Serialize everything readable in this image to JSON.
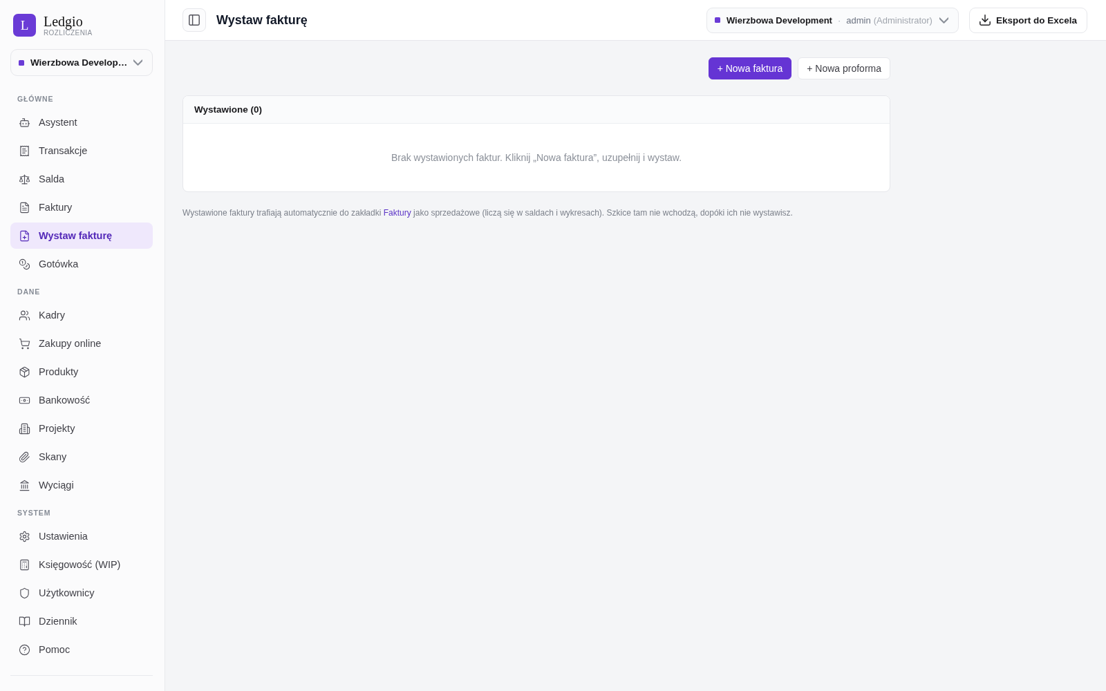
{
  "sidebar": {
    "logo": {
      "letter": "L",
      "name": "Ledgio",
      "subtitle": "ROZLICZENIA"
    },
    "company_selector": {
      "label": "Wierzbowa Develop…"
    },
    "sections": [
      {
        "title": "GŁÓWNE",
        "items": [
          {
            "label": "Asystent",
            "selected": false
          },
          {
            "label": "Transakcje",
            "selected": false
          },
          {
            "label": "Salda",
            "selected": false
          },
          {
            "label": "Faktury",
            "selected": false
          },
          {
            "label": "Wystaw fakturę",
            "selected": true
          },
          {
            "label": "Gotówka",
            "selected": false
          }
        ]
      },
      {
        "title": "DANE",
        "items": [
          {
            "label": "Kadry",
            "selected": false
          },
          {
            "label": "Zakupy online",
            "selected": false
          },
          {
            "label": "Produkty",
            "selected": false
          },
          {
            "label": "Bankowość",
            "selected": false
          },
          {
            "label": "Projekty",
            "selected": false
          },
          {
            "label": "Skany",
            "selected": false
          },
          {
            "label": "Wyciągi",
            "selected": false
          }
        ]
      },
      {
        "title": "SYSTEM",
        "items": [
          {
            "label": "Ustawienia",
            "selected": false
          },
          {
            "label": "Księgowość (WIP)",
            "selected": false
          },
          {
            "label": "Użytkownicy",
            "selected": false
          },
          {
            "label": "Dziennik",
            "selected": false
          },
          {
            "label": "Pomoc",
            "selected": false
          }
        ]
      }
    ]
  },
  "header": {
    "title": "Wystaw fakturę",
    "account": {
      "company": "Wierzbowa Development",
      "separator": "·",
      "user": "admin",
      "role": "(Administrator)"
    },
    "export_button": "Eksport do Excela"
  },
  "actions": [
    {
      "label": "+ Nowa faktura",
      "kind": "primary"
    },
    {
      "label": "+ Nowa proforma",
      "kind": "secondary"
    }
  ],
  "issued_panel": {
    "title": "Wystawione (0)",
    "empty_message": "Brak wystawionych faktur. Kliknij „Nowa faktura”, uzupełnij i wystaw."
  },
  "footnote": {
    "text_before": "Wystawione faktury trafiają automatycznie do zakładki",
    "link": "Faktury",
    "text_after": "jako sprzedażowe (liczą się w saldach i wykresach). Szkice tam nie wchodzą, dopóki ich nie wystawisz."
  }
}
